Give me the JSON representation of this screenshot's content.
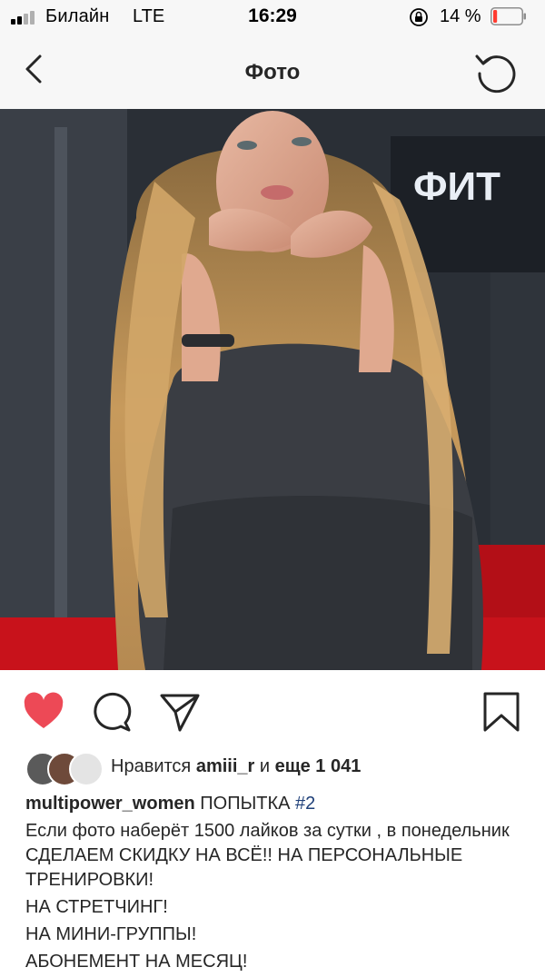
{
  "status_bar": {
    "carrier": "Билайн",
    "network": "LTE",
    "time": "16:29",
    "battery_percent": "14 %",
    "battery_level": 0.14,
    "battery_color": "#ff3b30"
  },
  "nav": {
    "back_icon": "chevron-left-icon",
    "title": "Фото",
    "refresh_icon": "refresh-icon"
  },
  "photo": {
    "sign_text": "ФИТ"
  },
  "actions": {
    "like_icon": "heart-filled-icon",
    "like_color": "#ed4956",
    "comment_icon": "comment-icon",
    "share_icon": "paper-plane-icon",
    "save_icon": "bookmark-icon"
  },
  "likes": {
    "prefix": "Нравится",
    "user": "amiii_r",
    "conjunction": "и",
    "others": "еще 1 041"
  },
  "caption": {
    "username": "multipower_women",
    "text_start": " ПОПЫТКА ",
    "hashtag": "#2",
    "line2": "Если фото наберёт 1500 лайков за сутки , в понедельник СДЕЛАЕМ СКИДКУ НА ВСЁ!! НА ПЕРСОНАЛЬНЫЕ ТРЕНИРОВКИ!",
    "line3": "НА СТРЕТЧИНГ!",
    "line4": "НА МИНИ-ГРУППЫ!",
    "line5": "АБОНЕМЕНТ НА МЕСЯЦ!"
  }
}
